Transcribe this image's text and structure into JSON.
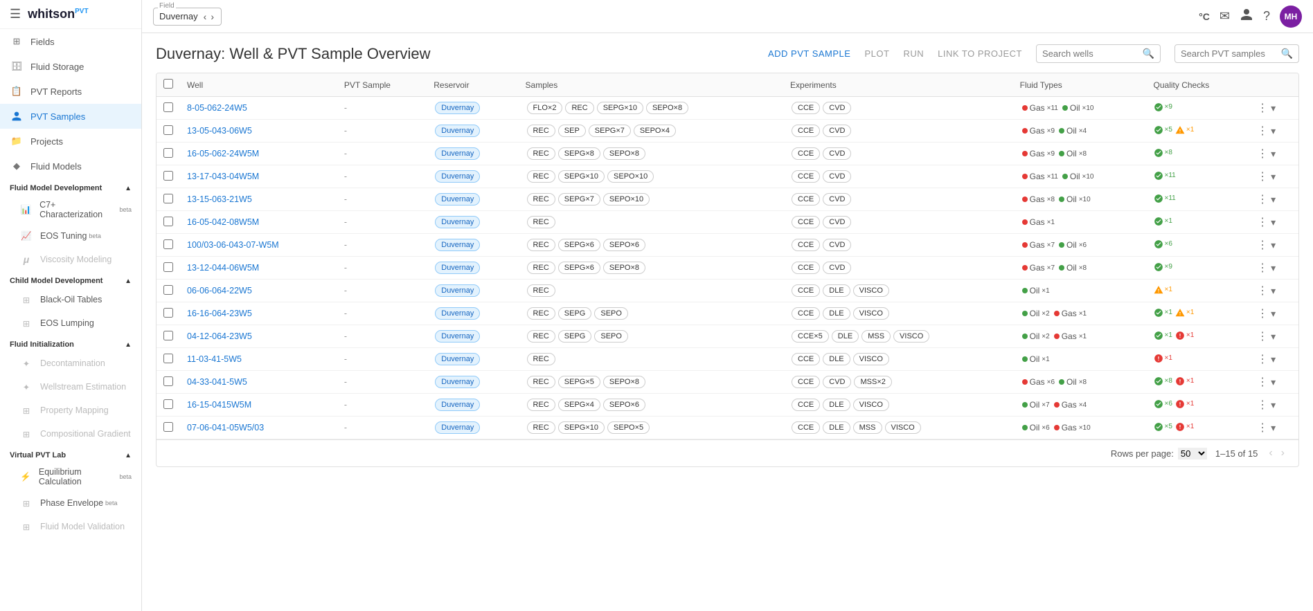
{
  "sidebar": {
    "logo": "whitson",
    "logo_sup": "PVT",
    "nav_items": [
      {
        "id": "fields",
        "label": "Fields",
        "icon": "⊞"
      },
      {
        "id": "fluid-storage",
        "label": "Fluid Storage",
        "icon": "🗄"
      },
      {
        "id": "pvt-reports",
        "label": "PVT Reports",
        "icon": "📋"
      },
      {
        "id": "pvt-samples",
        "label": "PVT Samples",
        "icon": "👤",
        "active": true
      },
      {
        "id": "projects",
        "label": "Projects",
        "icon": "📁"
      },
      {
        "id": "fluid-models",
        "label": "Fluid Models",
        "icon": "🔷"
      }
    ],
    "sections": [
      {
        "label": "Fluid Model Development",
        "items": [
          {
            "id": "c7-char",
            "label": "C7+ Characterization",
            "badge": "beta",
            "icon": "📊"
          },
          {
            "id": "eos-tuning",
            "label": "EOS Tuning",
            "badge": "beta",
            "icon": "📈"
          },
          {
            "id": "viscosity",
            "label": "Viscosity Modeling",
            "icon": "μ",
            "disabled": true
          }
        ]
      },
      {
        "label": "Child Model Development",
        "items": [
          {
            "id": "black-oil",
            "label": "Black-Oil Tables",
            "icon": "⊞"
          },
          {
            "id": "eos-lumping",
            "label": "EOS Lumping",
            "icon": "⊞"
          }
        ]
      },
      {
        "label": "Fluid Initialization",
        "items": [
          {
            "id": "decontamination",
            "label": "Decontamination",
            "icon": "✦",
            "disabled": true
          },
          {
            "id": "wellstream",
            "label": "Wellstream Estimation",
            "icon": "✦",
            "disabled": true
          },
          {
            "id": "property-mapping",
            "label": "Property Mapping",
            "icon": "⊞",
            "disabled": true
          },
          {
            "id": "comp-gradient",
            "label": "Compositional Gradient",
            "icon": "⊞",
            "disabled": true
          }
        ]
      },
      {
        "label": "Virtual PVT Lab",
        "items": [
          {
            "id": "equilibrium",
            "label": "Equilibrium Calculation",
            "badge": "beta",
            "icon": "⚡"
          },
          {
            "id": "phase-envelope",
            "label": "Phase Envelope",
            "badge": "beta",
            "icon": "⊞"
          },
          {
            "id": "fluid-validation",
            "label": "Fluid Model Validation",
            "icon": "⊞",
            "disabled": true
          }
        ]
      }
    ]
  },
  "header": {
    "field_label": "Field",
    "field_value": "Duvernay",
    "topbar_icons": [
      "°C",
      "✉",
      "👤",
      "?"
    ],
    "avatar": "MH"
  },
  "page": {
    "title": "Duvernay: Well & PVT Sample Overview",
    "actions": {
      "add": "ADD PVT SAMPLE",
      "plot": "PLOT",
      "run": "RUN",
      "link": "LINK TO PROJECT"
    },
    "search_wells_placeholder": "Search wells",
    "search_samples_placeholder": "Search PVT samples"
  },
  "table": {
    "columns": [
      "",
      "Well",
      "PVT Sample",
      "Reservoir",
      "Samples",
      "Experiments",
      "Fluid Types",
      "Quality Checks",
      ""
    ],
    "rows": [
      {
        "well": "8-05-062-24W5",
        "pvt_sample": "-",
        "reservoir": "Duvernay",
        "samples": [
          "FLO×2",
          "REC",
          "SEPG×10",
          "SEPO×8"
        ],
        "experiments": [
          "CCE",
          "CVD"
        ],
        "fluids": [
          {
            "type": "gas",
            "label": "Gas",
            "count": "×11"
          },
          {
            "type": "oil",
            "label": "Oil",
            "count": "×10"
          }
        ],
        "quality": [
          {
            "type": "ok",
            "count": "×9"
          }
        ]
      },
      {
        "well": "13-05-043-06W5",
        "pvt_sample": "-",
        "reservoir": "Duvernay",
        "samples": [
          "REC",
          "SEP",
          "SEPG×7",
          "SEPO×4"
        ],
        "experiments": [
          "CCE",
          "CVD"
        ],
        "fluids": [
          {
            "type": "gas",
            "label": "Gas",
            "count": "×9"
          },
          {
            "type": "oil",
            "label": "Oil",
            "count": "×4"
          }
        ],
        "quality": [
          {
            "type": "ok",
            "count": "×5"
          },
          {
            "type": "warn",
            "count": "×1"
          }
        ]
      },
      {
        "well": "16-05-062-24W5M",
        "pvt_sample": "-",
        "reservoir": "Duvernay",
        "samples": [
          "REC",
          "SEPG×8",
          "SEPO×8"
        ],
        "experiments": [
          "CCE",
          "CVD"
        ],
        "fluids": [
          {
            "type": "gas",
            "label": "Gas",
            "count": "×9"
          },
          {
            "type": "oil",
            "label": "Oil",
            "count": "×8"
          }
        ],
        "quality": [
          {
            "type": "ok",
            "count": "×8"
          }
        ]
      },
      {
        "well": "13-17-043-04W5M",
        "pvt_sample": "-",
        "reservoir": "Duvernay",
        "samples": [
          "REC",
          "SEPG×10",
          "SEPO×10"
        ],
        "experiments": [
          "CCE",
          "CVD"
        ],
        "fluids": [
          {
            "type": "gas",
            "label": "Gas",
            "count": "×11"
          },
          {
            "type": "oil",
            "label": "Oil",
            "count": "×10"
          }
        ],
        "quality": [
          {
            "type": "ok",
            "count": "×11"
          }
        ]
      },
      {
        "well": "13-15-063-21W5",
        "pvt_sample": "-",
        "reservoir": "Duvernay",
        "samples": [
          "REC",
          "SEPG×7",
          "SEPO×10"
        ],
        "experiments": [
          "CCE",
          "CVD"
        ],
        "fluids": [
          {
            "type": "gas",
            "label": "Gas",
            "count": "×8"
          },
          {
            "type": "oil",
            "label": "Oil",
            "count": "×10"
          }
        ],
        "quality": [
          {
            "type": "ok",
            "count": "×11"
          }
        ]
      },
      {
        "well": "16-05-042-08W5M",
        "pvt_sample": "-",
        "reservoir": "Duvernay",
        "samples": [
          "REC"
        ],
        "experiments": [
          "CCE",
          "CVD"
        ],
        "fluids": [
          {
            "type": "gas",
            "label": "Gas",
            "count": "×1"
          }
        ],
        "quality": [
          {
            "type": "ok",
            "count": "×1"
          }
        ]
      },
      {
        "well": "100/03-06-043-07-W5M",
        "pvt_sample": "-",
        "reservoir": "Duvernay",
        "samples": [
          "REC",
          "SEPG×6",
          "SEPO×6"
        ],
        "experiments": [
          "CCE",
          "CVD"
        ],
        "fluids": [
          {
            "type": "gas",
            "label": "Gas",
            "count": "×7"
          },
          {
            "type": "oil",
            "label": "Oil",
            "count": "×6"
          }
        ],
        "quality": [
          {
            "type": "ok",
            "count": "×6"
          }
        ]
      },
      {
        "well": "13-12-044-06W5M",
        "pvt_sample": "-",
        "reservoir": "Duvernay",
        "samples": [
          "REC",
          "SEPG×6",
          "SEPO×8"
        ],
        "experiments": [
          "CCE",
          "CVD"
        ],
        "fluids": [
          {
            "type": "gas",
            "label": "Gas",
            "count": "×7"
          },
          {
            "type": "oil",
            "label": "Oil",
            "count": "×8"
          }
        ],
        "quality": [
          {
            "type": "ok",
            "count": "×9"
          }
        ]
      },
      {
        "well": "06-06-064-22W5",
        "pvt_sample": "-",
        "reservoir": "Duvernay",
        "samples": [
          "REC"
        ],
        "experiments": [
          "CCE",
          "DLE",
          "VISCO"
        ],
        "fluids": [
          {
            "type": "oil",
            "label": "Oil",
            "count": "×1"
          }
        ],
        "quality": [
          {
            "type": "warn",
            "count": "×1"
          }
        ]
      },
      {
        "well": "16-16-064-23W5",
        "pvt_sample": "-",
        "reservoir": "Duvernay",
        "samples": [
          "REC",
          "SEPG",
          "SEPO"
        ],
        "experiments": [
          "CCE",
          "DLE",
          "VISCO"
        ],
        "fluids": [
          {
            "type": "oil",
            "label": "Oil",
            "count": "×2"
          },
          {
            "type": "gas",
            "label": "Gas",
            "count": "×1"
          }
        ],
        "quality": [
          {
            "type": "ok",
            "count": "×1"
          },
          {
            "type": "warn",
            "count": "×1"
          }
        ]
      },
      {
        "well": "04-12-064-23W5",
        "pvt_sample": "-",
        "reservoir": "Duvernay",
        "samples": [
          "REC",
          "SEPG",
          "SEPO"
        ],
        "experiments": [
          "CCE×5",
          "DLE",
          "MSS",
          "VISCO"
        ],
        "fluids": [
          {
            "type": "oil",
            "label": "Oil",
            "count": "×2"
          },
          {
            "type": "gas",
            "label": "Gas",
            "count": "×1"
          }
        ],
        "quality": [
          {
            "type": "ok",
            "count": "×1"
          },
          {
            "type": "error",
            "count": "×1"
          }
        ]
      },
      {
        "well": "11-03-41-5W5",
        "pvt_sample": "-",
        "reservoir": "Duvernay",
        "samples": [
          "REC"
        ],
        "experiments": [
          "CCE",
          "DLE",
          "VISCO"
        ],
        "fluids": [
          {
            "type": "oil",
            "label": "Oil",
            "count": "×1"
          }
        ],
        "quality": [
          {
            "type": "error",
            "count": "×1"
          }
        ]
      },
      {
        "well": "04-33-041-5W5",
        "pvt_sample": "-",
        "reservoir": "Duvernay",
        "samples": [
          "REC",
          "SEPG×5",
          "SEPO×8"
        ],
        "experiments": [
          "CCE",
          "CVD",
          "MSS×2"
        ],
        "fluids": [
          {
            "type": "gas",
            "label": "Gas",
            "count": "×6"
          },
          {
            "type": "oil",
            "label": "Oil",
            "count": "×8"
          }
        ],
        "quality": [
          {
            "type": "ok",
            "count": "×8"
          },
          {
            "type": "error",
            "count": "×1"
          }
        ]
      },
      {
        "well": "16-15-0415W5M",
        "pvt_sample": "-",
        "reservoir": "Duvernay",
        "samples": [
          "REC",
          "SEPG×4",
          "SEPO×6"
        ],
        "experiments": [
          "CCE",
          "DLE",
          "VISCO"
        ],
        "fluids": [
          {
            "type": "oil",
            "label": "Oil",
            "count": "×7"
          },
          {
            "type": "gas",
            "label": "Gas",
            "count": "×4"
          }
        ],
        "quality": [
          {
            "type": "ok",
            "count": "×6"
          },
          {
            "type": "error",
            "count": "×1"
          }
        ]
      },
      {
        "well": "07-06-041-05W5/03",
        "pvt_sample": "-",
        "reservoir": "Duvernay",
        "samples": [
          "REC",
          "SEPG×10",
          "SEPO×5"
        ],
        "experiments": [
          "CCE",
          "DLE",
          "MSS",
          "VISCO"
        ],
        "fluids": [
          {
            "type": "oil",
            "label": "Oil",
            "count": "×6"
          },
          {
            "type": "gas",
            "label": "Gas",
            "count": "×10"
          }
        ],
        "quality": [
          {
            "type": "ok",
            "count": "×5"
          },
          {
            "type": "error",
            "count": "×1"
          }
        ]
      }
    ],
    "footer": {
      "rows_per_page_label": "Rows per page:",
      "rows_per_page_value": "50",
      "pagination_info": "1–15 of 15"
    }
  }
}
